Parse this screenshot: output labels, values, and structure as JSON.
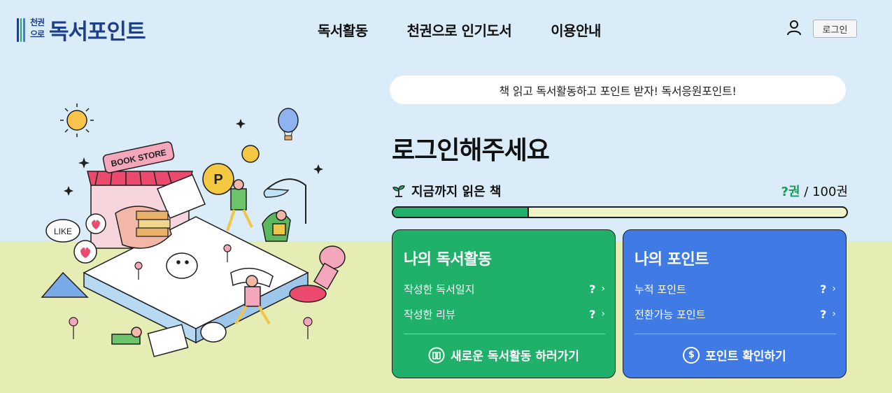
{
  "logo": {
    "badge_line1": "천권",
    "badge_line2": "으로",
    "title": "독서포인트",
    "bar_colors": [
      "#1e3f8a",
      "#1fb06a",
      "#3f7ae5"
    ]
  },
  "nav": {
    "items": [
      {
        "label": "독서활동"
      },
      {
        "label": "천권으로 인기도서"
      },
      {
        "label": "이용안내"
      }
    ]
  },
  "header": {
    "user_icon": "user-icon",
    "login_label": "로그인"
  },
  "illustration": {
    "sign_text": "BOOK STORE",
    "like_text": "LIKE",
    "coin_text": "P"
  },
  "banner": {
    "text": "책 읽고 독서활동하고 포인트 받자! 독서응원포인트!"
  },
  "main": {
    "login_prompt": "로그인해주세요",
    "read_label": "지금까지 읽은 책",
    "read_count_value": "?권",
    "read_count_sep": " / ",
    "read_count_goal": "100권",
    "progress_fraction": 0.3
  },
  "activity_card": {
    "title": "나의 독서활동",
    "rows": [
      {
        "label": "작성한 독서일지",
        "value": "?"
      },
      {
        "label": "작성한 리뷰",
        "value": "?"
      }
    ],
    "action_label": "새로운 독서활동 하러가기",
    "color": "#1fb06a"
  },
  "points_card": {
    "title": "나의 포인트",
    "rows": [
      {
        "label": "누적 포인트",
        "value": "?"
      },
      {
        "label": "전환가능 포인트",
        "value": "?"
      }
    ],
    "action_label": "포인트 확인하기",
    "action_icon_symbol": "$",
    "color": "#3f7ae5"
  }
}
